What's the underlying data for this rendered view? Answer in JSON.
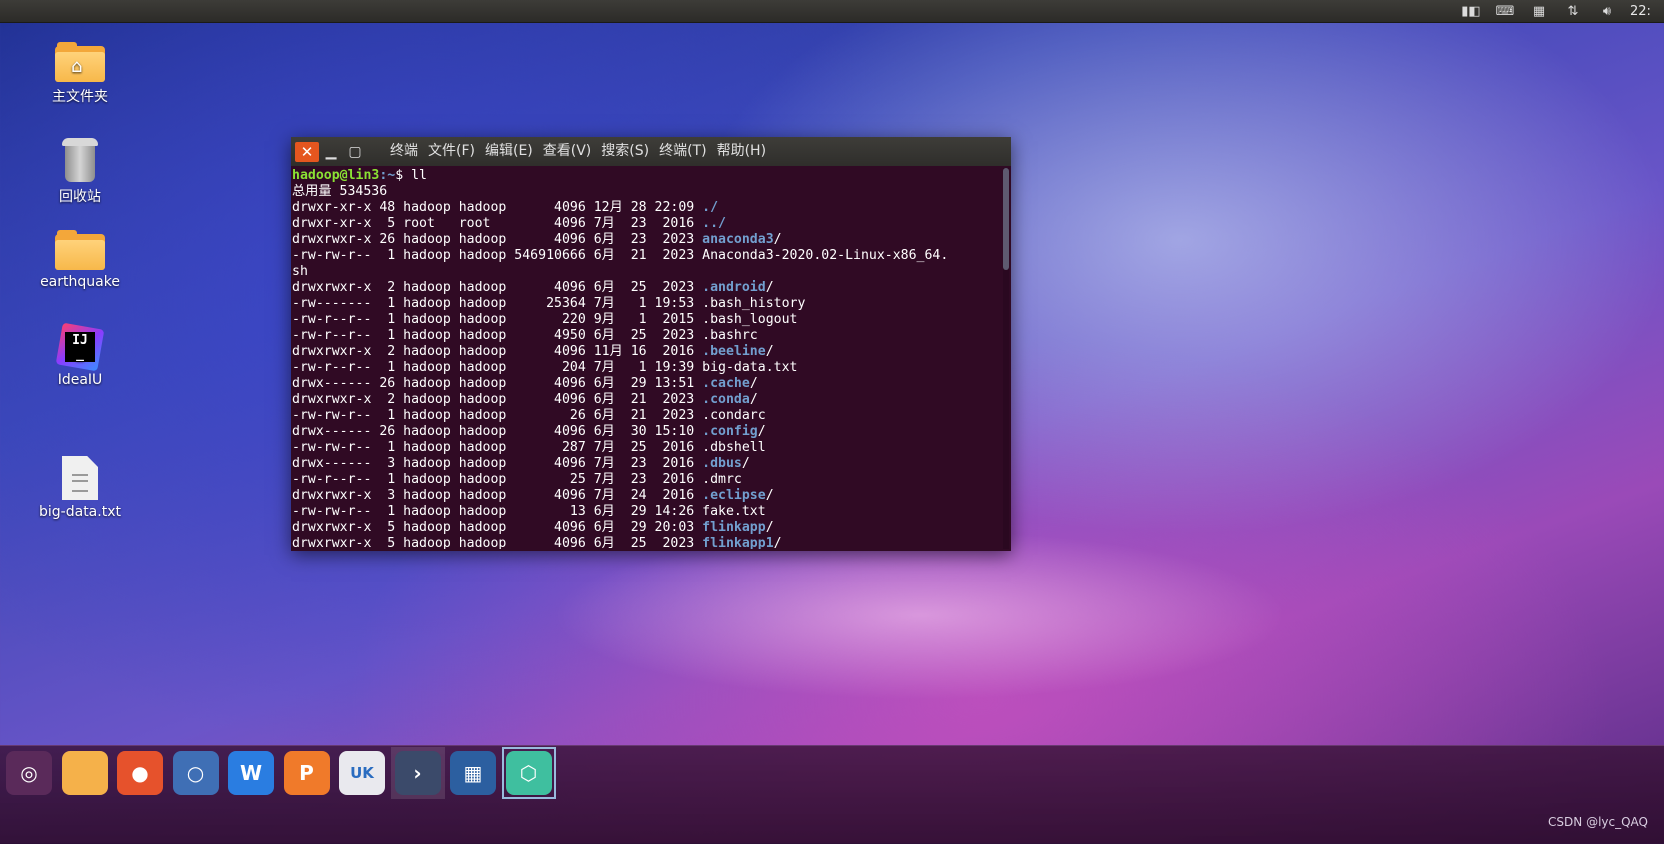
{
  "panel": {
    "clock": "22:"
  },
  "desktop_icons": [
    {
      "label": "主文件夹",
      "icon": "home-folder-icon"
    },
    {
      "label": "回收站",
      "icon": "trash-icon"
    },
    {
      "label": "earthquake",
      "icon": "folder-icon"
    },
    {
      "label": "IdeaIU",
      "icon": "intellij-idea-icon"
    },
    {
      "label": "big-data.txt",
      "icon": "text-file-icon"
    }
  ],
  "terminal": {
    "menu": [
      "终端",
      "文件(F)",
      "编辑(E)",
      "查看(V)",
      "搜索(S)",
      "终端(T)",
      "帮助(H)"
    ],
    "prompt_user": "hadoop@lin3",
    "prompt_path": ":~",
    "prompt_cmd": "$ ll",
    "total_line": "总用量 534536",
    "rows": [
      {
        "meta": "drwxr-xr-x 48 hadoop hadoop      4096 12月 28 22:09 ",
        "name": "./",
        "type": "dir"
      },
      {
        "meta": "drwxr-xr-x  5 root   root        4096 7月  23  2016 ",
        "name": "../",
        "type": "dir"
      },
      {
        "meta": "drwxrwxr-x 26 hadoop hadoop      4096 6月  23  2023 ",
        "name": "anaconda3",
        "suffix": "/",
        "type": "dir"
      },
      {
        "meta": "-rw-rw-r--  1 hadoop hadoop 546910666 6月  21  2023 ",
        "name": "Anaconda3-2020.02-Linux-x86_64.",
        "type": "file"
      },
      {
        "meta": "",
        "name": "sh",
        "type": "file"
      },
      {
        "meta": "drwxrwxr-x  2 hadoop hadoop      4096 6月  25  2023 ",
        "name": ".android",
        "suffix": "/",
        "type": "dir"
      },
      {
        "meta": "-rw-------  1 hadoop hadoop     25364 7月   1 19:53 ",
        "name": ".bash_history",
        "type": "file"
      },
      {
        "meta": "-rw-r--r--  1 hadoop hadoop       220 9月   1  2015 ",
        "name": ".bash_logout",
        "type": "file"
      },
      {
        "meta": "-rw-r--r--  1 hadoop hadoop      4950 6月  25  2023 ",
        "name": ".bashrc",
        "type": "file"
      },
      {
        "meta": "drwxrwxr-x  2 hadoop hadoop      4096 11月 16  2016 ",
        "name": ".beeline",
        "suffix": "/",
        "type": "dir"
      },
      {
        "meta": "-rw-r--r--  1 hadoop hadoop       204 7月   1 19:39 ",
        "name": "big-data.txt",
        "type": "file"
      },
      {
        "meta": "drwx------ 26 hadoop hadoop      4096 6月  29 13:51 ",
        "name": ".cache",
        "suffix": "/",
        "type": "dir"
      },
      {
        "meta": "drwxrwxr-x  2 hadoop hadoop      4096 6月  21  2023 ",
        "name": ".conda",
        "suffix": "/",
        "type": "dir"
      },
      {
        "meta": "-rw-rw-r--  1 hadoop hadoop        26 6月  21  2023 ",
        "name": ".condarc",
        "type": "file"
      },
      {
        "meta": "drwx------ 26 hadoop hadoop      4096 6月  30 15:10 ",
        "name": ".config",
        "suffix": "/",
        "type": "dir"
      },
      {
        "meta": "-rw-rw-r--  1 hadoop hadoop       287 7月  25  2016 ",
        "name": ".dbshell",
        "type": "file"
      },
      {
        "meta": "drwx------  3 hadoop hadoop      4096 7月  23  2016 ",
        "name": ".dbus",
        "suffix": "/",
        "type": "dir"
      },
      {
        "meta": "-rw-r--r--  1 hadoop hadoop        25 7月  23  2016 ",
        "name": ".dmrc",
        "type": "file"
      },
      {
        "meta": "drwxrwxr-x  3 hadoop hadoop      4096 7月  24  2016 ",
        "name": ".eclipse",
        "suffix": "/",
        "type": "dir"
      },
      {
        "meta": "-rw-rw-r--  1 hadoop hadoop        13 6月  29 14:26 ",
        "name": "fake.txt",
        "type": "file"
      },
      {
        "meta": "drwxrwxr-x  5 hadoop hadoop      4096 6月  29 20:03 ",
        "name": "flinkapp",
        "suffix": "/",
        "type": "dir"
      },
      {
        "meta": "drwxrwxr-x  5 hadoop hadoop      4096 6月  25  2023 ",
        "name": "flinkapp1",
        "suffix": "/",
        "type": "dir"
      }
    ]
  },
  "launcher": {
    "items": [
      {
        "name": "ubuntu-dash",
        "icon": "ubuntu-logo-icon",
        "bg": "#5a2a5a",
        "glyph": "◎"
      },
      {
        "name": "files",
        "icon": "files-folder-icon",
        "bg": "#f5b14a",
        "glyph": ""
      },
      {
        "name": "firefox",
        "icon": "firefox-icon",
        "bg": "#e6522c",
        "glyph": "●"
      },
      {
        "name": "chromium",
        "icon": "chromium-icon",
        "bg": "#3f6fb5",
        "glyph": "○"
      },
      {
        "name": "wps-writer",
        "icon": "wps-writer-icon",
        "bg": "#2a7de1",
        "glyph": "W"
      },
      {
        "name": "wps-presentation",
        "icon": "wps-presentation-icon",
        "bg": "#f07a2a",
        "glyph": "P"
      },
      {
        "name": "ubuntu-kylin-store",
        "icon": "software-store-icon",
        "bg": "#e9e9ee",
        "glyph": "UK"
      },
      {
        "name": "terminal",
        "icon": "terminal-icon",
        "bg": "#3b4a6a",
        "glyph": "›"
      },
      {
        "name": "workspace-switcher",
        "icon": "workspace-switcher-icon",
        "bg": "#2c5fa0",
        "glyph": "▦"
      },
      {
        "name": "shadowsocks",
        "icon": "vpn-shield-icon",
        "bg": "#3fbf9f",
        "glyph": "⬡"
      }
    ]
  },
  "watermark": "CSDN @lyc_QAQ"
}
